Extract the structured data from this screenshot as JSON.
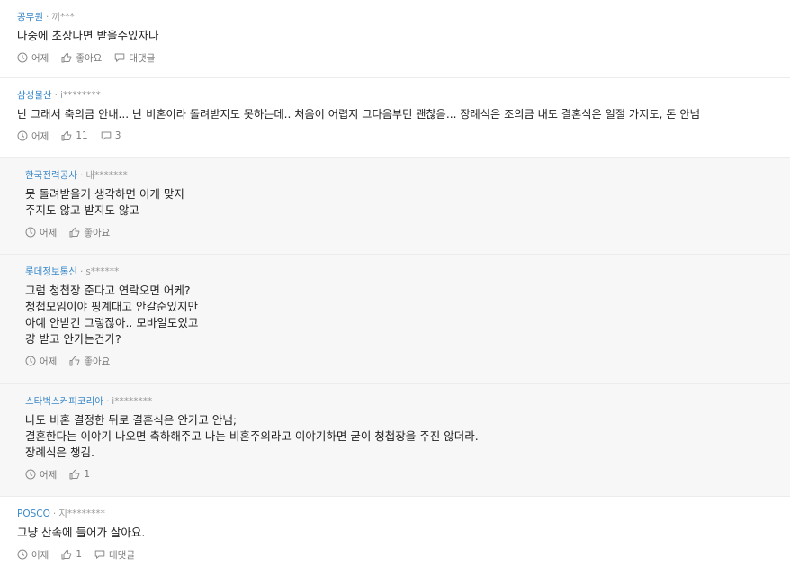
{
  "comments": [
    {
      "company": "공무원",
      "user": "끼***",
      "lines": [
        "나중에 초상나면 받을수있자나"
      ],
      "time": "어제",
      "like": "좋아요",
      "reply": "대댓글"
    },
    {
      "company": "삼성물산",
      "user": "i********",
      "lines": [
        "난 그래서 축의금 안내... 난 비혼이라 돌려받지도 못하는데.. 처음이 어렵지 그다음부턴 괜찮음... 장례식은 조의금 내도 결혼식은 일절 가지도, 돈 안냄"
      ],
      "time": "어제",
      "like": "11",
      "reply": "3"
    },
    {
      "company": "한국전력공사",
      "user": "내*******",
      "lines": [
        "못 돌려받을거 생각하면 이게 맞지",
        "주지도 않고 받지도 않고"
      ],
      "time": "어제",
      "like": "좋아요"
    },
    {
      "company": "롯데정보통신",
      "user": "s******",
      "lines": [
        "그럼 청첩장 준다고 연락오면 어케?",
        "청첩모임이야 핑계대고 안갈순있지만",
        "아예 안받긴 그렇잖아.. 모바일도있고",
        "걍 받고 안가는건가?"
      ],
      "time": "어제",
      "like": "좋아요"
    },
    {
      "company": "스타벅스커피코리아",
      "user": "i********",
      "lines": [
        "나도 비혼 결정한 뒤로 결혼식은 안가고 안냄;",
        "결혼한다는 이야기 나오면 축하해주고 나는 비혼주의라고 이야기하면 굳이 청첩장을 주진 않더라.",
        "장례식은 챙김."
      ],
      "time": "어제",
      "like": "1"
    },
    {
      "company": "POSCO",
      "user": "지********",
      "lines": [
        "그냥 산속에 들어가 살아요."
      ],
      "time": "어제",
      "like": "1",
      "reply": "대댓글"
    }
  ],
  "meta_separator": "·",
  "icons": {
    "time": "clock-icon",
    "like": "thumbs-up-icon",
    "reply": "speech-bubble-icon"
  },
  "colors": {
    "company": "#3a88c9",
    "muted": "#9a9a9a",
    "reply_background": "#f7f7f7"
  }
}
